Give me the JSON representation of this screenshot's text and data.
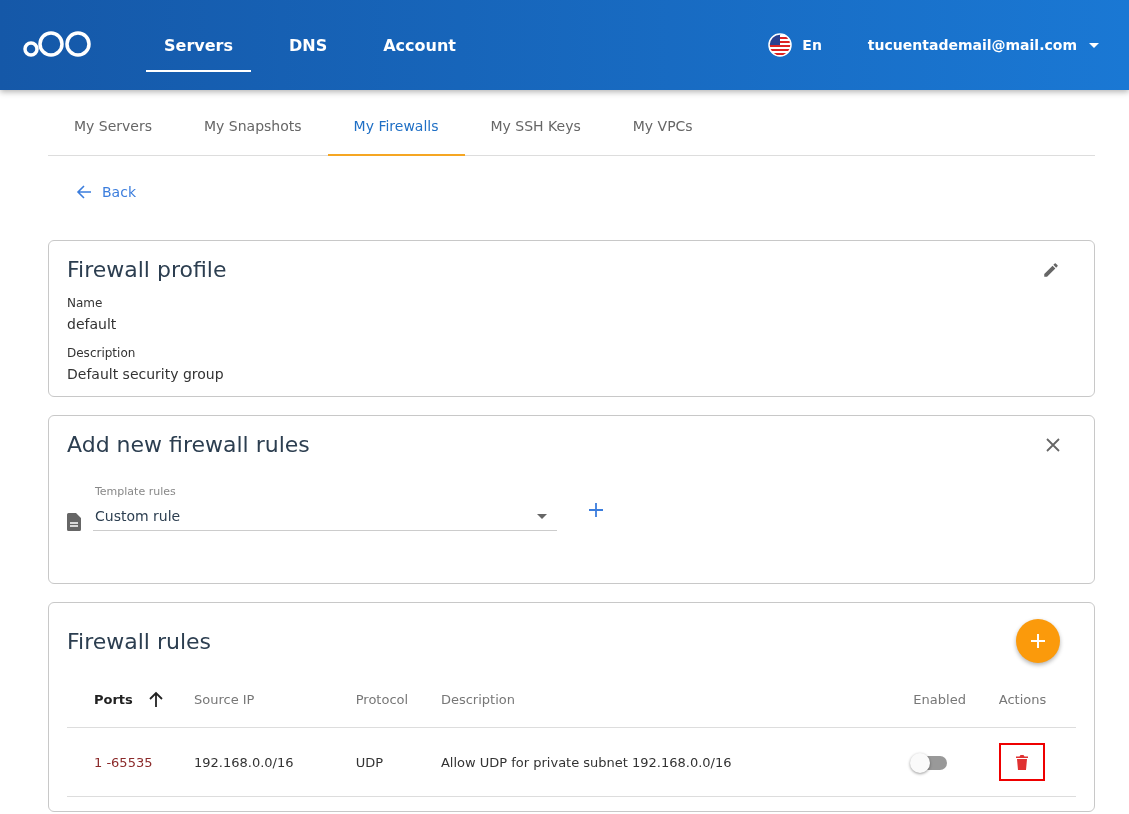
{
  "top_nav": {
    "items": [
      {
        "label": "Servers",
        "selected": true
      },
      {
        "label": "DNS",
        "selected": false
      },
      {
        "label": "Account",
        "selected": false
      }
    ],
    "language": "En",
    "user_email": "tucuentademail@mail.com"
  },
  "sub_tabs": [
    {
      "label": "My Servers",
      "selected": false
    },
    {
      "label": "My Snapshots",
      "selected": false
    },
    {
      "label": "My Firewalls",
      "selected": true
    },
    {
      "label": "My SSH Keys",
      "selected": false
    },
    {
      "label": "My VPCs",
      "selected": false
    }
  ],
  "back_link": "Back",
  "profile": {
    "title": "Firewall profile",
    "fields": [
      {
        "label": "Name",
        "value": "default"
      },
      {
        "label": "Description",
        "value": "Default security group"
      }
    ]
  },
  "add_rules": {
    "title": "Add new firewall rules",
    "template_select": {
      "label": "Template rules",
      "value": "Custom rule"
    }
  },
  "rules": {
    "title": "Firewall rules",
    "columns": [
      {
        "label": "Ports",
        "sorted": true
      },
      {
        "label": "Source IP",
        "sorted": false
      },
      {
        "label": "Protocol",
        "sorted": false
      },
      {
        "label": "Description",
        "sorted": false
      },
      {
        "label": "Enabled",
        "sorted": false
      },
      {
        "label": "Actions",
        "sorted": false
      }
    ],
    "rows": [
      {
        "ports": "1 -65535",
        "source_ip": "192.168.0.0/16",
        "protocol": "UDP",
        "description": "Allow UDP for private subnet 192.168.0.0/16",
        "enabled": false,
        "delete_highlighted": true
      }
    ]
  }
}
